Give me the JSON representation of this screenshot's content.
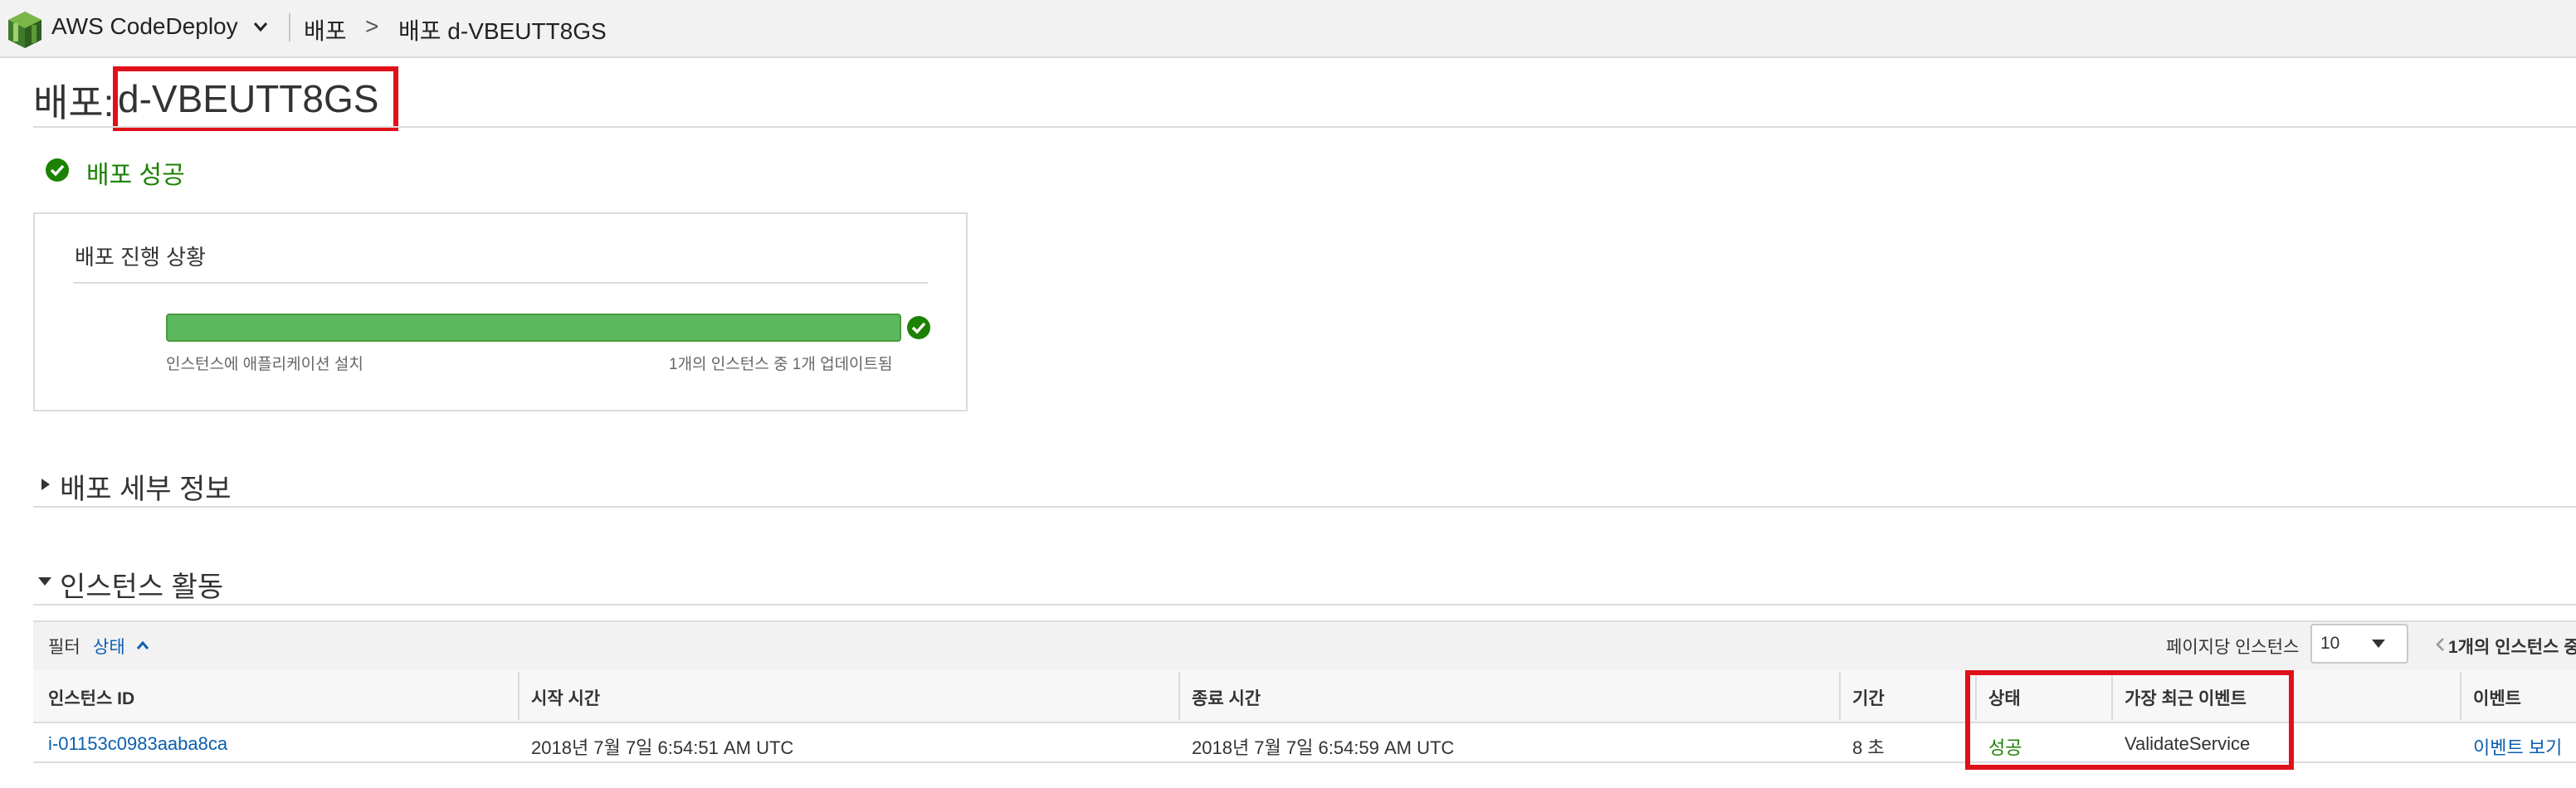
{
  "topbar": {
    "app_name": "AWS CodeDeploy",
    "breadcrumb": [
      "배포",
      "배포 d-VBEUTT8GS"
    ],
    "breadcrumb_sep": ">"
  },
  "page": {
    "title_label": "배포:",
    "title_id": "d-VBEUTT8GS"
  },
  "status": {
    "text": "배포 성공",
    "color": "#1d8102"
  },
  "progress": {
    "title": "배포 진행 상황",
    "fraction": 1.0,
    "left_caption": "인스턴스에 애플리케이션 설치",
    "right_caption": "1개의 인스턴스 중 1개 업데이트됨"
  },
  "details_section": {
    "label": "배포 세부 정보"
  },
  "activity_section": {
    "label": "인스턴스 활동"
  },
  "filter": {
    "label": "필터",
    "value": "상태",
    "per_page_label": "페이지당 인스턴스",
    "per_page_value": "10",
    "pagination_text": "1개의 인스턴스 중"
  },
  "table": {
    "columns": [
      "인스턴스 ID",
      "시작 시간",
      "종료 시간",
      "기간",
      "상태",
      "가장 최근 이벤트",
      "이벤트"
    ],
    "rows": [
      {
        "instance_id": "i-01153c0983aaba8ca",
        "start": "2018년 7월 7일 6:54:51 AM UTC",
        "end": "2018년 7월 7일 6:54:59 AM UTC",
        "duration": "8 초",
        "status": "성공",
        "latest_event": "ValidateService",
        "events_link": "이벤트 보기"
      }
    ]
  },
  "colors": {
    "accent_link": "#0b5fb0",
    "success": "#1d8102",
    "highlight_box": "#e0101a",
    "progress_bar": "#5cb85c"
  }
}
